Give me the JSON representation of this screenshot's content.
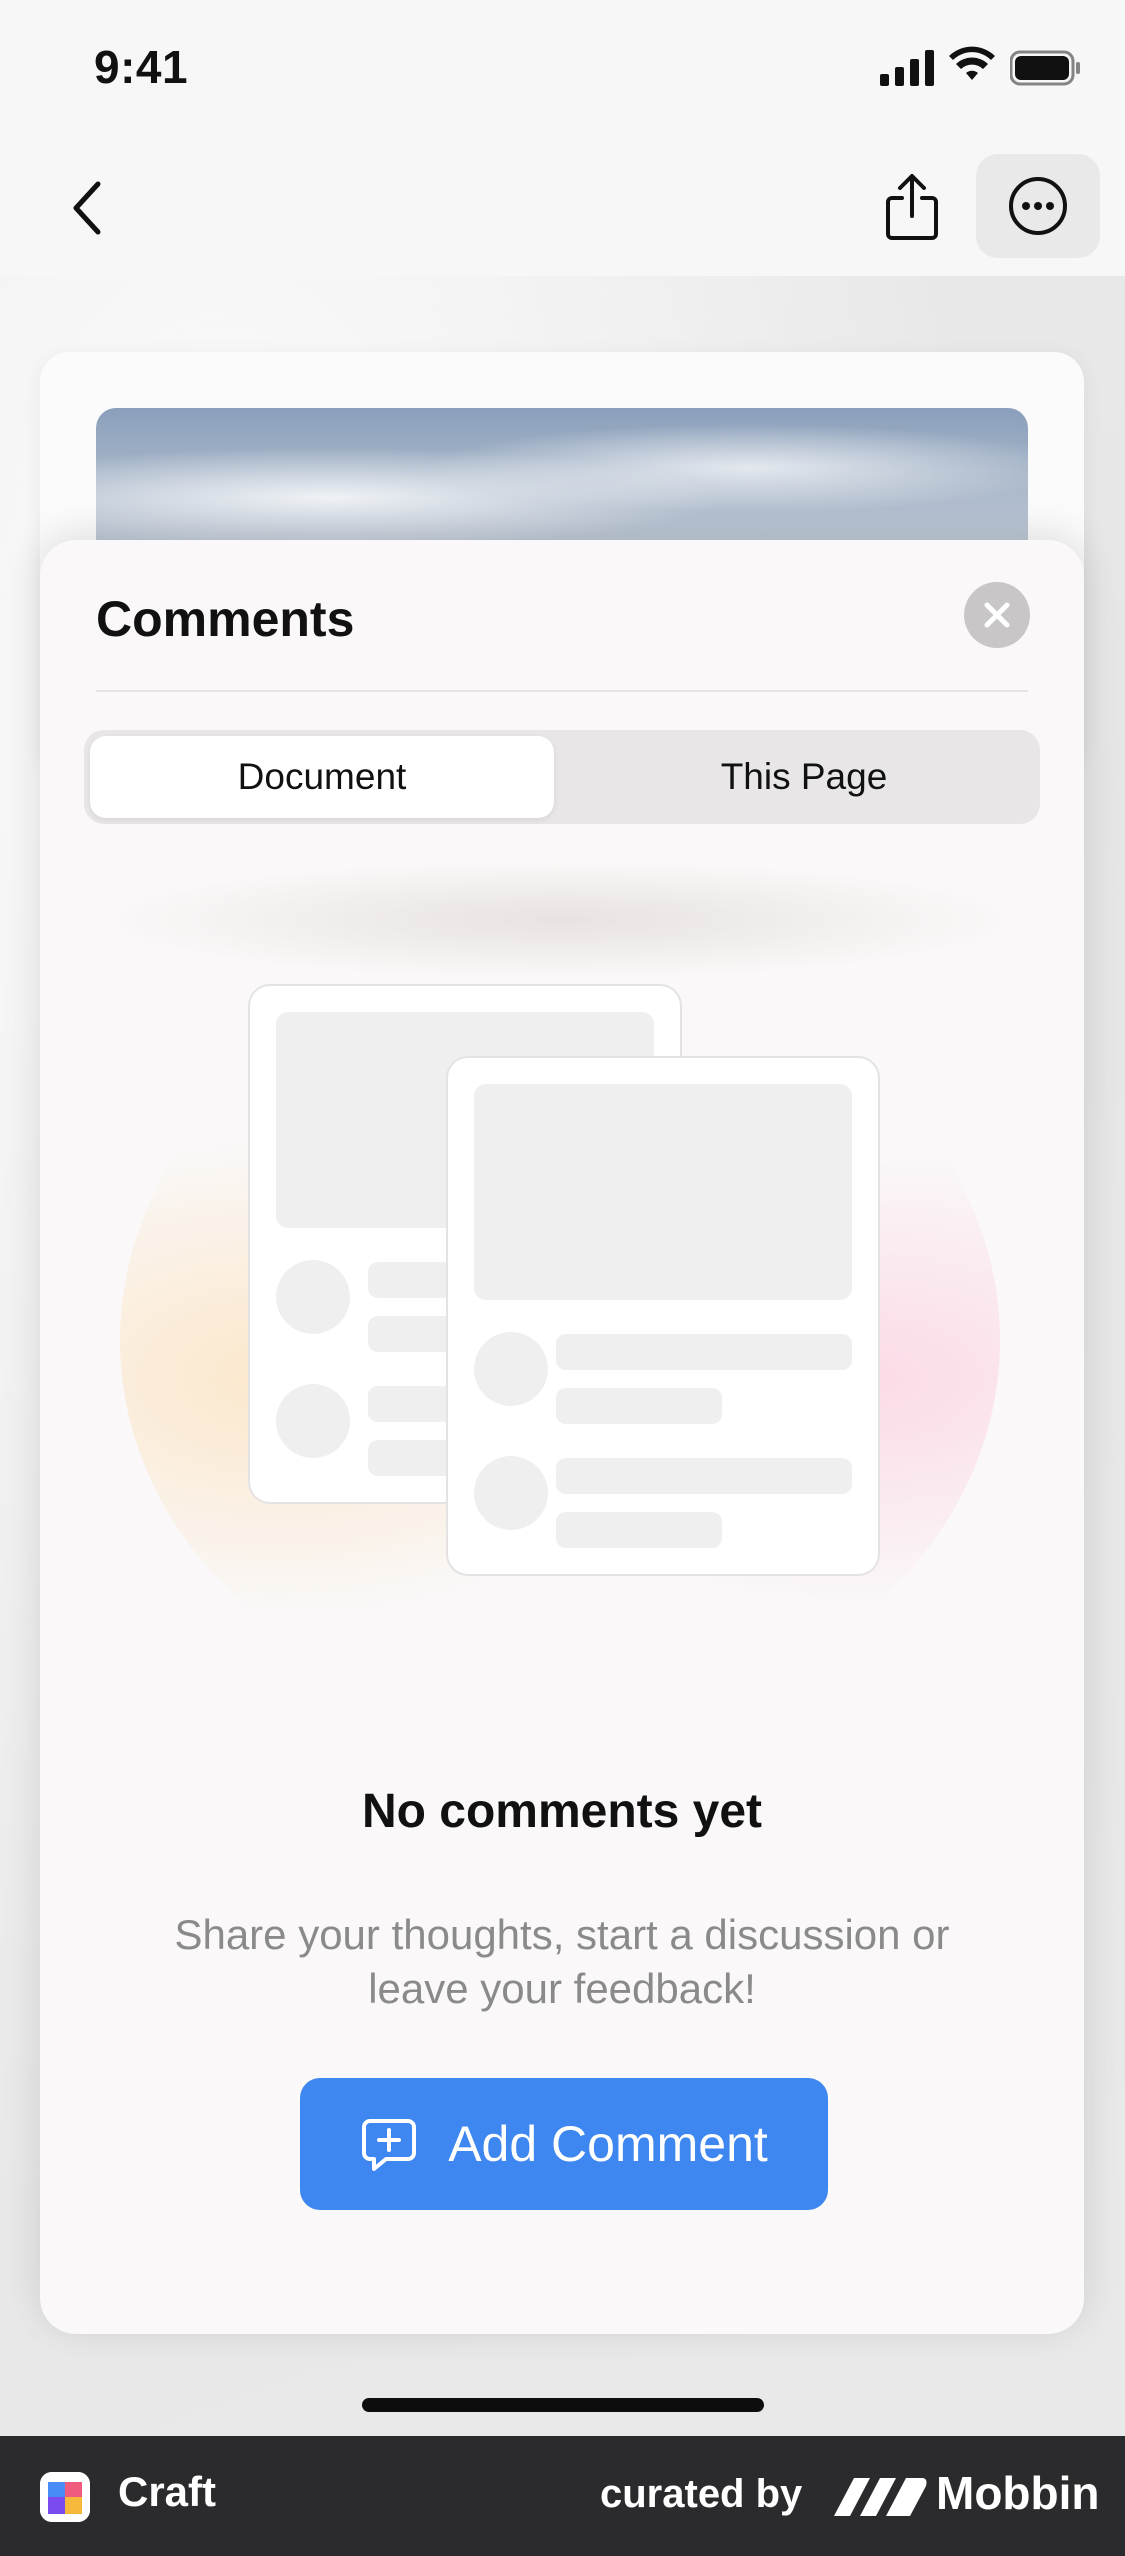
{
  "status_bar": {
    "time": "9:41"
  },
  "nav": {
    "back_icon": "chevron-left-icon",
    "share_icon": "share-icon",
    "more_icon": "ellipsis-circle-icon"
  },
  "comments_sheet": {
    "title": "Comments",
    "tabs": [
      {
        "label": "Document",
        "selected": true
      },
      {
        "label": "This Page",
        "selected": false
      }
    ],
    "empty_state": {
      "title": "No comments yet",
      "description": "Share your thoughts, start a discussion or leave your feedback!"
    },
    "add_button": {
      "label": "Add Comment",
      "icon": "comment-plus-icon"
    }
  },
  "footer": {
    "app_name": "Craft",
    "curated_by": "curated by",
    "brand": "Mobbin"
  },
  "colors": {
    "accent": "#3e86f0",
    "footer_bg": "#2b2b2d"
  }
}
